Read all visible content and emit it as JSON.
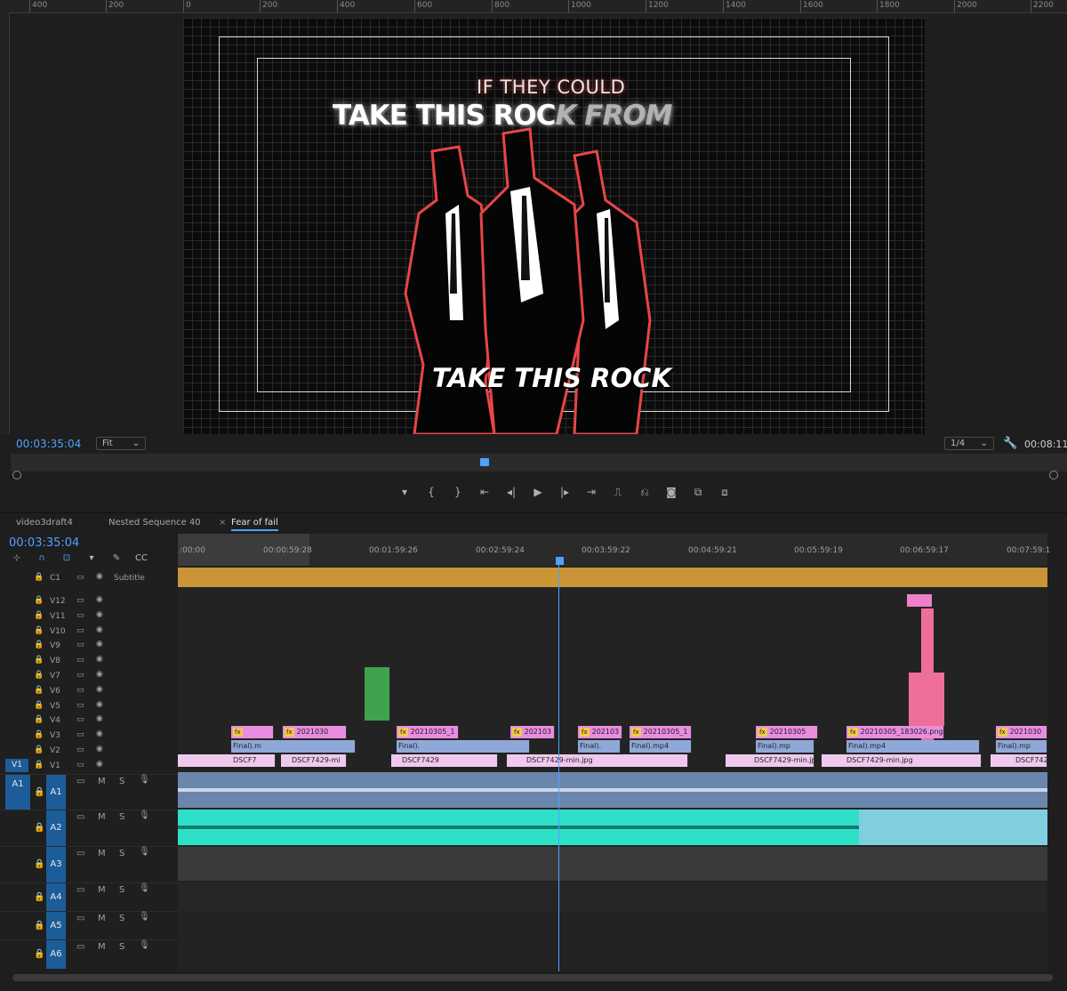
{
  "ruler": {
    "ticks": [
      "400",
      "200",
      "0",
      "200",
      "400",
      "600",
      "800",
      "1000",
      "1200",
      "1400",
      "1600",
      "1800",
      "2000",
      "2200"
    ]
  },
  "monitor": {
    "overlay_line1": "IF THEY COULD",
    "overlay_line2_main": "TAKE THIS ROC",
    "overlay_line2_ghost": "K FROM",
    "overlay_bottom": "TAKE THIS ROCK",
    "timecode": "00:03:35:04",
    "zoom": "Fit",
    "resolution": "1/4",
    "duration": "00:08:11"
  },
  "transport": {
    "buttons": [
      "add-marker",
      "mark-in",
      "mark-out",
      "go-to-in",
      "step-back",
      "play",
      "step-forward",
      "go-to-out",
      "lift",
      "extract",
      "export-frame",
      "insert",
      "overwrite"
    ]
  },
  "timeline": {
    "tabs": [
      "video3draft4",
      "Nested Sequence 40",
      "Fear of fail"
    ],
    "active_tab": "Fear of fail",
    "timecode": "00:03:35:04",
    "ruler_labels": [
      ":00:00",
      "00:00:59:28",
      "00:01:59:26",
      "00:02:59:24",
      "00:03:59:22",
      "00:04:59:21",
      "00:05:59:19",
      "00:06:59:17",
      "00:07:59:1"
    ],
    "subtitle_track": {
      "name": "C1",
      "label": "Subtitle"
    },
    "video_tracks": [
      "V12",
      "V11",
      "V10",
      "V9",
      "V8",
      "V7",
      "V6",
      "V5",
      "V4",
      "V3",
      "V2",
      "V1"
    ],
    "source_patch_video": "V1",
    "audio_tracks": [
      "A1",
      "A2",
      "A3",
      "A4",
      "A5",
      "A6"
    ],
    "source_patch_audio": "A1",
    "audio_buttons": {
      "mute": "M",
      "solo": "S"
    },
    "clips_v3": [
      "2021030",
      "20210305_1",
      "202103",
      "202103",
      "20210305_1",
      "20210305",
      "20210305_183026.png",
      "2021030"
    ],
    "clips_v2": [
      "Final).m",
      "Final).",
      "Final).",
      "Final).mp4",
      "Final).mp",
      "Final).mp4",
      "Final).mp"
    ],
    "clips_v1": [
      "DSCF7",
      "DSCF7429-mi",
      "DSCF7429",
      "DSCF7429-min.jpg",
      "DSCF7429-min.jpg",
      "DSCF7429-min.jpg",
      "DSCF742"
    ],
    "fx_label": "fx"
  },
  "colors": {
    "accent": "#4da3ff",
    "patch": "#1c5d99",
    "audio_a2": "#2fe0c8"
  }
}
